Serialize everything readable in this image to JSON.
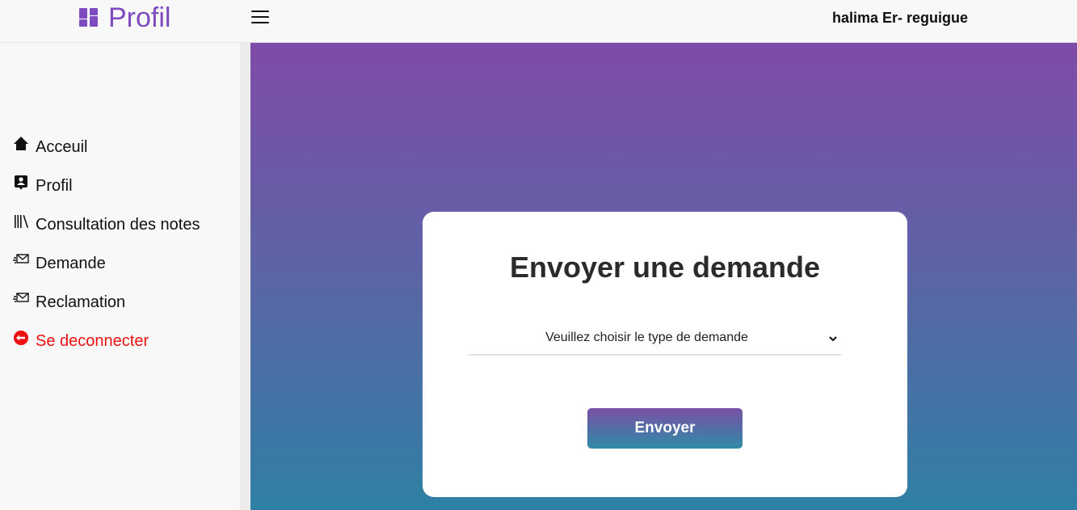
{
  "header": {
    "brand_title": "Profil",
    "brand_icon": "dashboard-icon",
    "menu_icon": "hamburger-icon",
    "username": "halima Er- reguigue"
  },
  "sidebar": {
    "items": [
      {
        "label": "Acceuil",
        "icon": "home-icon"
      },
      {
        "label": "Profil",
        "icon": "profile-badge-icon"
      },
      {
        "label": "Consultation des notes",
        "icon": "library-icon"
      },
      {
        "label": "Demande",
        "icon": "mail-send-icon"
      },
      {
        "label": "Reclamation",
        "icon": "mail-send-icon"
      },
      {
        "label": "Se deconnecter",
        "icon": "logout-icon"
      }
    ]
  },
  "form": {
    "title": "Envoyer une demande",
    "select_value": "Veuillez choisir le type de demande",
    "submit_label": "Envoyer"
  },
  "colors": {
    "accent": "#7e4bc0",
    "danger": "#ee1111",
    "gradient_top": "#7f4ba8",
    "gradient_bottom": "#2f80a5"
  }
}
